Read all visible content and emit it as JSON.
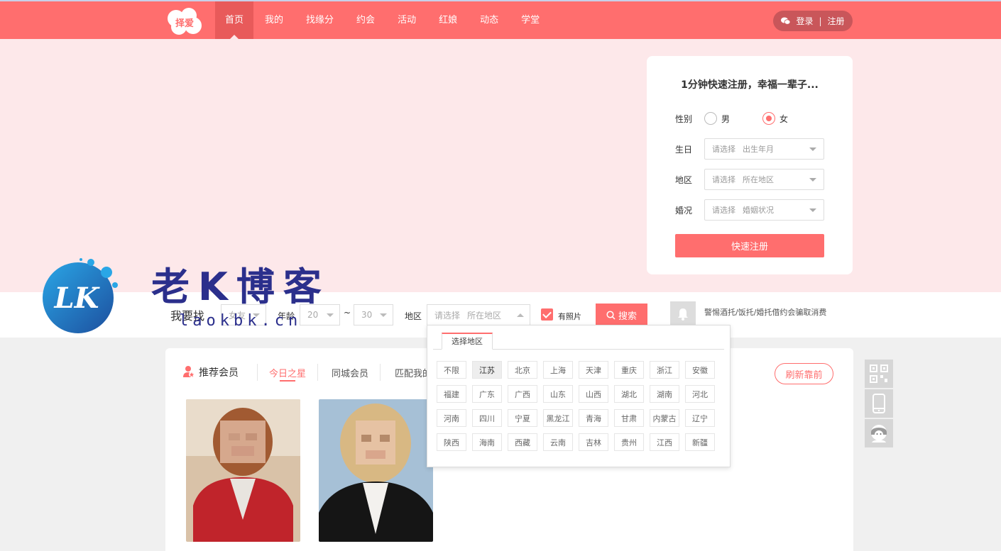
{
  "header": {
    "logo_text": "择爱",
    "nav": [
      "首页",
      "我的",
      "找缘分",
      "约会",
      "活动",
      "红娘",
      "动态",
      "学堂"
    ],
    "login": "登录",
    "sep": "|",
    "register": "注册"
  },
  "reg_card": {
    "title": "1分钟快速注册，幸福一辈子...",
    "gender_label": "性别",
    "male": "男",
    "female": "女",
    "selected_gender": "女",
    "birthday_label": "生日",
    "birthday_ph1": "请选择",
    "birthday_ph2": "出生年月",
    "region_label": "地区",
    "region_ph1": "请选择",
    "region_ph2": "所在地区",
    "marital_label": "婚况",
    "marital_ph1": "请选择",
    "marital_ph2": "婚姻状况",
    "submit": "快速注册"
  },
  "search": {
    "title": "我要找",
    "gender_value": "女友",
    "age_label": "年龄",
    "age_from": "20",
    "tilde": "~",
    "age_to": "30",
    "region_label": "地区",
    "region_ph1": "请选择",
    "region_ph2": "所在地区",
    "photo_label": "有照片",
    "photo_checked": true,
    "button": "搜索",
    "warning": "警惕酒托/饭托/婚托借约会骗取消费"
  },
  "region_dropdown": {
    "tab": "选择地区",
    "selected": "江苏",
    "items": [
      "不限",
      "江苏",
      "北京",
      "上海",
      "天津",
      "重庆",
      "浙江",
      "安徽",
      "福建",
      "广东",
      "广西",
      "山东",
      "山西",
      "湖北",
      "湖南",
      "河北",
      "河南",
      "四川",
      "宁夏",
      "黑龙江",
      "青海",
      "甘肃",
      "内蒙古",
      "辽宁",
      "陕西",
      "海南",
      "西藏",
      "云南",
      "吉林",
      "贵州",
      "江西",
      "新疆"
    ]
  },
  "members": {
    "title": "推荐会员",
    "tabs": [
      "今日之星",
      "同城会员",
      "匹配我的"
    ],
    "active_tab": "今日之星",
    "refresh": "刷新靠前"
  },
  "watermark": {
    "text": "老K博客",
    "url": "laokbk.cn",
    "circle_text": "LK"
  },
  "colors": {
    "brand": "#ff6e6e",
    "hero_bg": "#fde8ea",
    "watermark": "#2b2f8c"
  }
}
